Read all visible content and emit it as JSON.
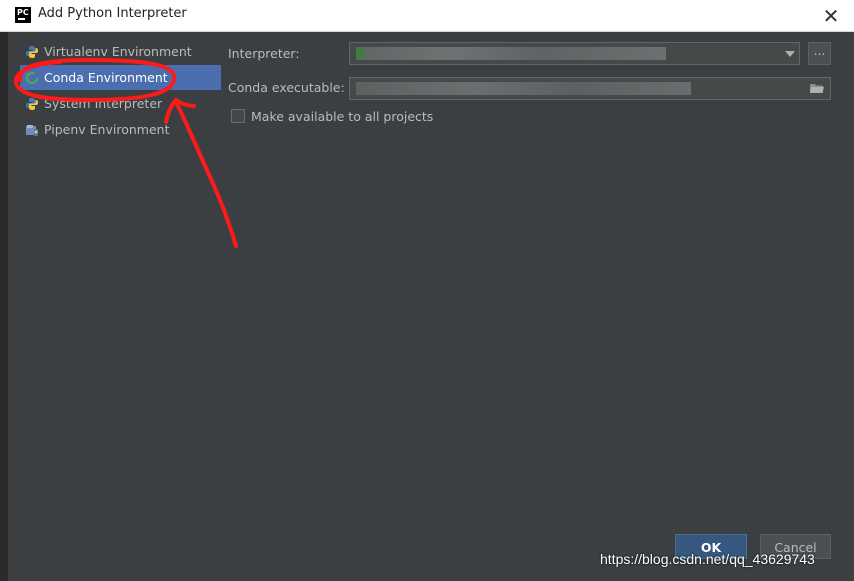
{
  "window": {
    "title": "Add Python Interpreter",
    "app_icon_text": "PC",
    "close_glyph": "✕"
  },
  "sidebar": {
    "items": [
      {
        "label": "Virtualenv Environment",
        "icon": "python-icon"
      },
      {
        "label": "Conda Environment",
        "icon": "conda-ring-icon",
        "selected": true
      },
      {
        "label": "System Interpreter",
        "icon": "python-icon"
      },
      {
        "label": "Pipenv Environment",
        "icon": "pipenv-icon"
      }
    ]
  },
  "form": {
    "interpreter_label": "Interpreter:",
    "interpreter_value": "",
    "browse_label": "...",
    "conda_label": "Conda executable:",
    "conda_value": "",
    "make_available_label": "Make available to all projects",
    "make_available_checked": false
  },
  "buttons": {
    "ok": "OK",
    "cancel": "Cancel"
  },
  "watermark": "https://blog.csdn.net/qq_43629743",
  "colors": {
    "selection": "#4b6eaf",
    "ok_button": "#365880",
    "annotation_red": "#ff1a1a"
  }
}
